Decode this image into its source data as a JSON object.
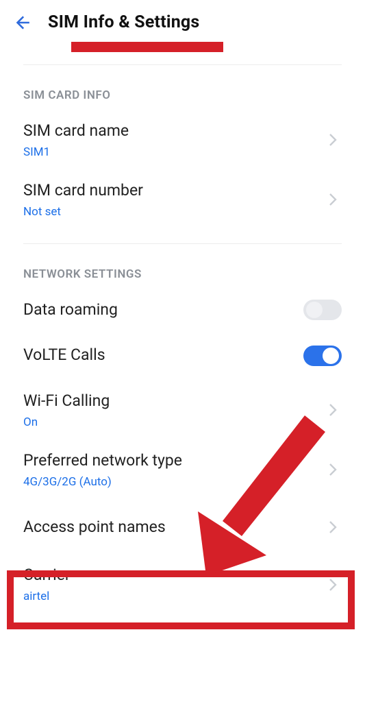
{
  "colors": {
    "accent": "#1c6fe8",
    "highlight": "#d52028",
    "muted": "#8a8f96"
  },
  "header": {
    "title": "SIM Info & Settings"
  },
  "sections": {
    "sim_card_info": {
      "header": "SIM CARD INFO",
      "items": {
        "sim_card_name": {
          "title": "SIM card name",
          "sub": "SIM1"
        },
        "sim_card_number": {
          "title": "SIM card number",
          "sub": "Not set"
        }
      }
    },
    "network_settings": {
      "header": "NETWORK SETTINGS",
      "items": {
        "data_roaming": {
          "title": "Data roaming",
          "toggle": false
        },
        "volte_calls": {
          "title": "VoLTE Calls",
          "toggle": true
        },
        "wifi_calling": {
          "title": "Wi-Fi Calling",
          "sub": "On"
        },
        "preferred_net": {
          "title": "Preferred network type",
          "sub": "4G/3G/2G (Auto)"
        },
        "apn": {
          "title": "Access point names"
        },
        "carrier": {
          "title": "Carrier",
          "sub": "airtel"
        }
      }
    }
  },
  "annotation": {
    "highlighted_item": "apn",
    "arrow_points_to": "apn"
  }
}
